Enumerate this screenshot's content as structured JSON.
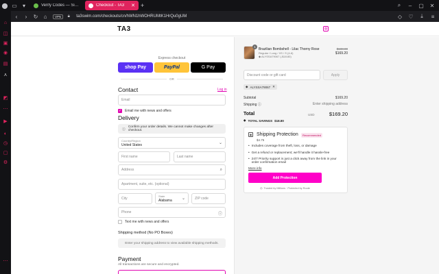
{
  "browser": {
    "tabs": [
      {
        "title": "Verify Codes — SimplyCo",
        "active": false,
        "favicon_color": "#6abf4b"
      },
      {
        "title": "Checkout - TA3",
        "active": true,
        "favicon_color": "#ffffff"
      }
    ],
    "new_tab_icon": "+",
    "vpn_label": "VPN",
    "url": "ta3swim.com/checkouts/cn/hWN1hWOHRUMtK1HrQu0gUM"
  },
  "header": {
    "logo": "TA3"
  },
  "express": {
    "label": "Express checkout",
    "shop_pay": "shop Pay",
    "paypal": "PayPal",
    "gpay": "G Pay",
    "or": "OR"
  },
  "contact": {
    "title": "Contact",
    "login_link": "Log in",
    "email_placeholder": "Email",
    "email_news": "Email me with news and offers"
  },
  "delivery": {
    "title": "Delivery",
    "notice": "Confirm your order details. We cannot make changes after checkout.",
    "country_label": "Country/Region",
    "country_value": "United States",
    "first_name": "First name",
    "last_name": "Last name",
    "address": "Address",
    "apartment": "Apartment, suite, etc. (optional)",
    "city": "City",
    "state_label": "State",
    "state_value": "Alabama",
    "zip": "ZIP code",
    "phone": "Phone",
    "text_news": "Text me with news and offers"
  },
  "shipping_method": {
    "title": "Shipping method (No PO Boxes)",
    "placeholder": "Enter your shipping address to view available shipping methods."
  },
  "payment": {
    "title": "Payment",
    "note": "All transactions are secure and encrypted."
  },
  "summary": {
    "product": {
      "quantity": "1",
      "name": "Brazilian Bombshell - Lilac Thorny Rose",
      "variant": "Regular / Long / XS / S (4-6)",
      "tag": "ALYSSA79067 (-$18.80)",
      "price_old": "$188.00",
      "price_new": "$169.20"
    },
    "discount_placeholder": "Discount code or gift card",
    "apply": "Apply",
    "applied_code": "ALYSSA79067",
    "subtotal_label": "Subtotal",
    "subtotal_value": "$169.20",
    "shipping_label": "Shipping",
    "shipping_value": "Enter shipping address",
    "total_label": "Total",
    "total_currency": "USD",
    "total_value": "$169.20",
    "savings_label": "TOTAL SAVINGS",
    "savings_value": "$18.80"
  },
  "protection": {
    "title": "Shipping Protection",
    "price": "$4.75",
    "badge": "Recommended",
    "bullets": [
      "Includes coverage from theft, loss, or damage",
      "Get a refund or replacement; we'll handle it hassle-free",
      "24/7 Priority support is just a click away from the link in your order confirmation email"
    ],
    "more_info": "More info",
    "button": "Add Protection",
    "trusted": "Trusted by Millions · Protected by Route"
  },
  "colors": {
    "accent": "#e000b0",
    "tab_active": "#e0245e",
    "protection_button": "#ff00c8"
  }
}
